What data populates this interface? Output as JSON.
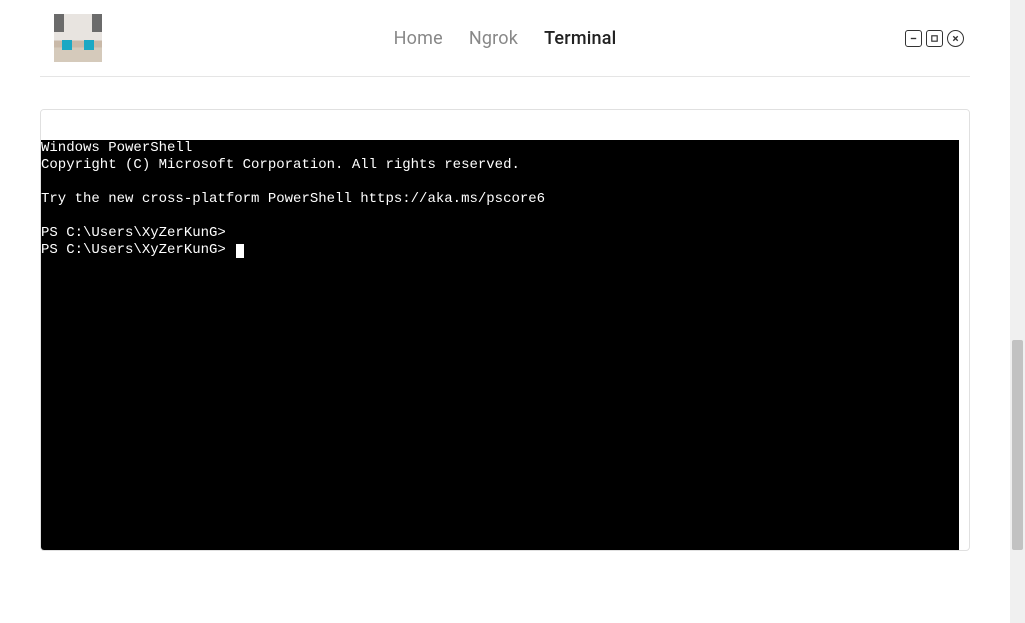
{
  "header": {
    "nav": [
      {
        "label": "Home",
        "active": false
      },
      {
        "label": "Ngrok",
        "active": false
      },
      {
        "label": "Terminal",
        "active": true
      }
    ]
  },
  "window_controls": {
    "minimize": "minimize",
    "maximize": "maximize",
    "close": "close"
  },
  "terminal": {
    "lines": [
      "Windows PowerShell",
      "Copyright (C) Microsoft Corporation. All rights reserved.",
      "",
      "Try the new cross-platform PowerShell https://aka.ms/pscore6",
      "",
      "PS C:\\Users\\XyZerKunG>"
    ],
    "prompt": "PS C:\\Users\\XyZerKunG> "
  }
}
